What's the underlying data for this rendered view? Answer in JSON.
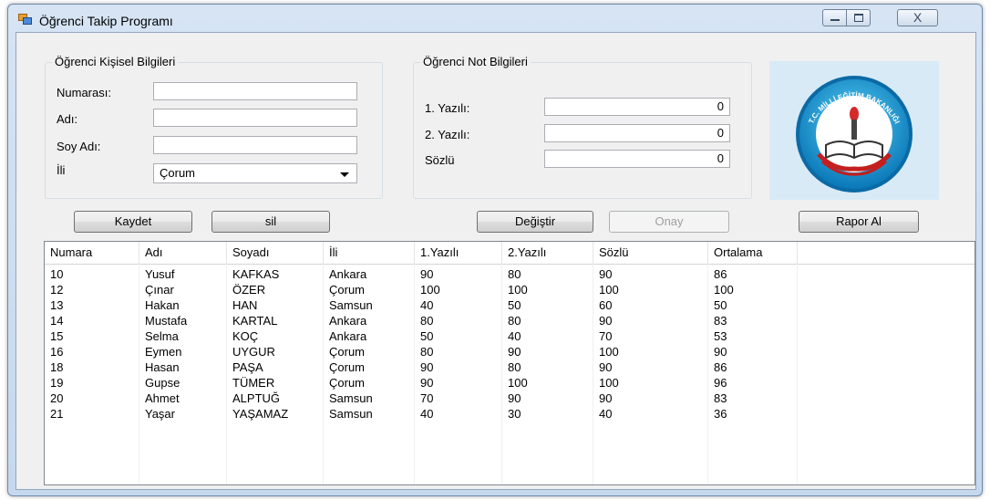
{
  "window": {
    "title": "Öğrenci Takip Programı",
    "close_glyph": "X"
  },
  "personal": {
    "group_title": "Öğrenci Kişisel Bilgileri",
    "number_label": "Numarası:",
    "name_label": "Adı:",
    "surname_label": "Soy Adı:",
    "city_label": "İli",
    "number_value": "",
    "name_value": "",
    "surname_value": "",
    "city_selected": "Çorum"
  },
  "grades": {
    "group_title": "Öğrenci Not Bilgileri",
    "exam1_label": "1. Yazılı:",
    "exam2_label": "2. Yazılı:",
    "oral_label": "Sözlü",
    "exam1_value": "0",
    "exam2_value": "0",
    "oral_value": "0"
  },
  "logo": {
    "text": "T.C. MİLLİ EĞİTİM BAKANLIĞI"
  },
  "buttons": {
    "save": "Kaydet",
    "delete": "sil",
    "change": "Değiştir",
    "confirm": "Onay",
    "report": "Rapor Al"
  },
  "table": {
    "columns": [
      "Numara",
      "Adı",
      "Soyadı",
      "İli",
      "1.Yazılı",
      "2.Yazılı",
      "Sözlü",
      "Ortalama"
    ],
    "rows": [
      [
        "10",
        "Yusuf",
        "KAFKAS",
        "Ankara",
        "90",
        "80",
        "90",
        "86"
      ],
      [
        "12",
        "Çınar",
        "ÖZER",
        "Çorum",
        "100",
        "100",
        "100",
        "100"
      ],
      [
        "13",
        "Hakan",
        "HAN",
        "Samsun",
        "40",
        "50",
        "60",
        "50"
      ],
      [
        "14",
        "Mustafa",
        "KARTAL",
        "Ankara",
        "80",
        "80",
        "90",
        "83"
      ],
      [
        "15",
        "Selma",
        "KOÇ",
        "Ankara",
        "50",
        "40",
        "70",
        "53"
      ],
      [
        "16",
        "Eymen",
        "UYGUR",
        "Çorum",
        "80",
        "90",
        "100",
        "90"
      ],
      [
        "18",
        "Hasan",
        "PAŞA",
        "Çorum",
        "90",
        "80",
        "90",
        "86"
      ],
      [
        "19",
        "Gupse",
        "TÜMER",
        "Çorum",
        "90",
        "100",
        "100",
        "96"
      ],
      [
        "20",
        "Ahmet",
        "ALPTUĞ",
        "Samsun",
        "70",
        "90",
        "90",
        "83"
      ],
      [
        "21",
        "Yaşar",
        "YAŞAMAZ",
        "Samsun",
        "40",
        "30",
        "40",
        "36"
      ]
    ]
  }
}
